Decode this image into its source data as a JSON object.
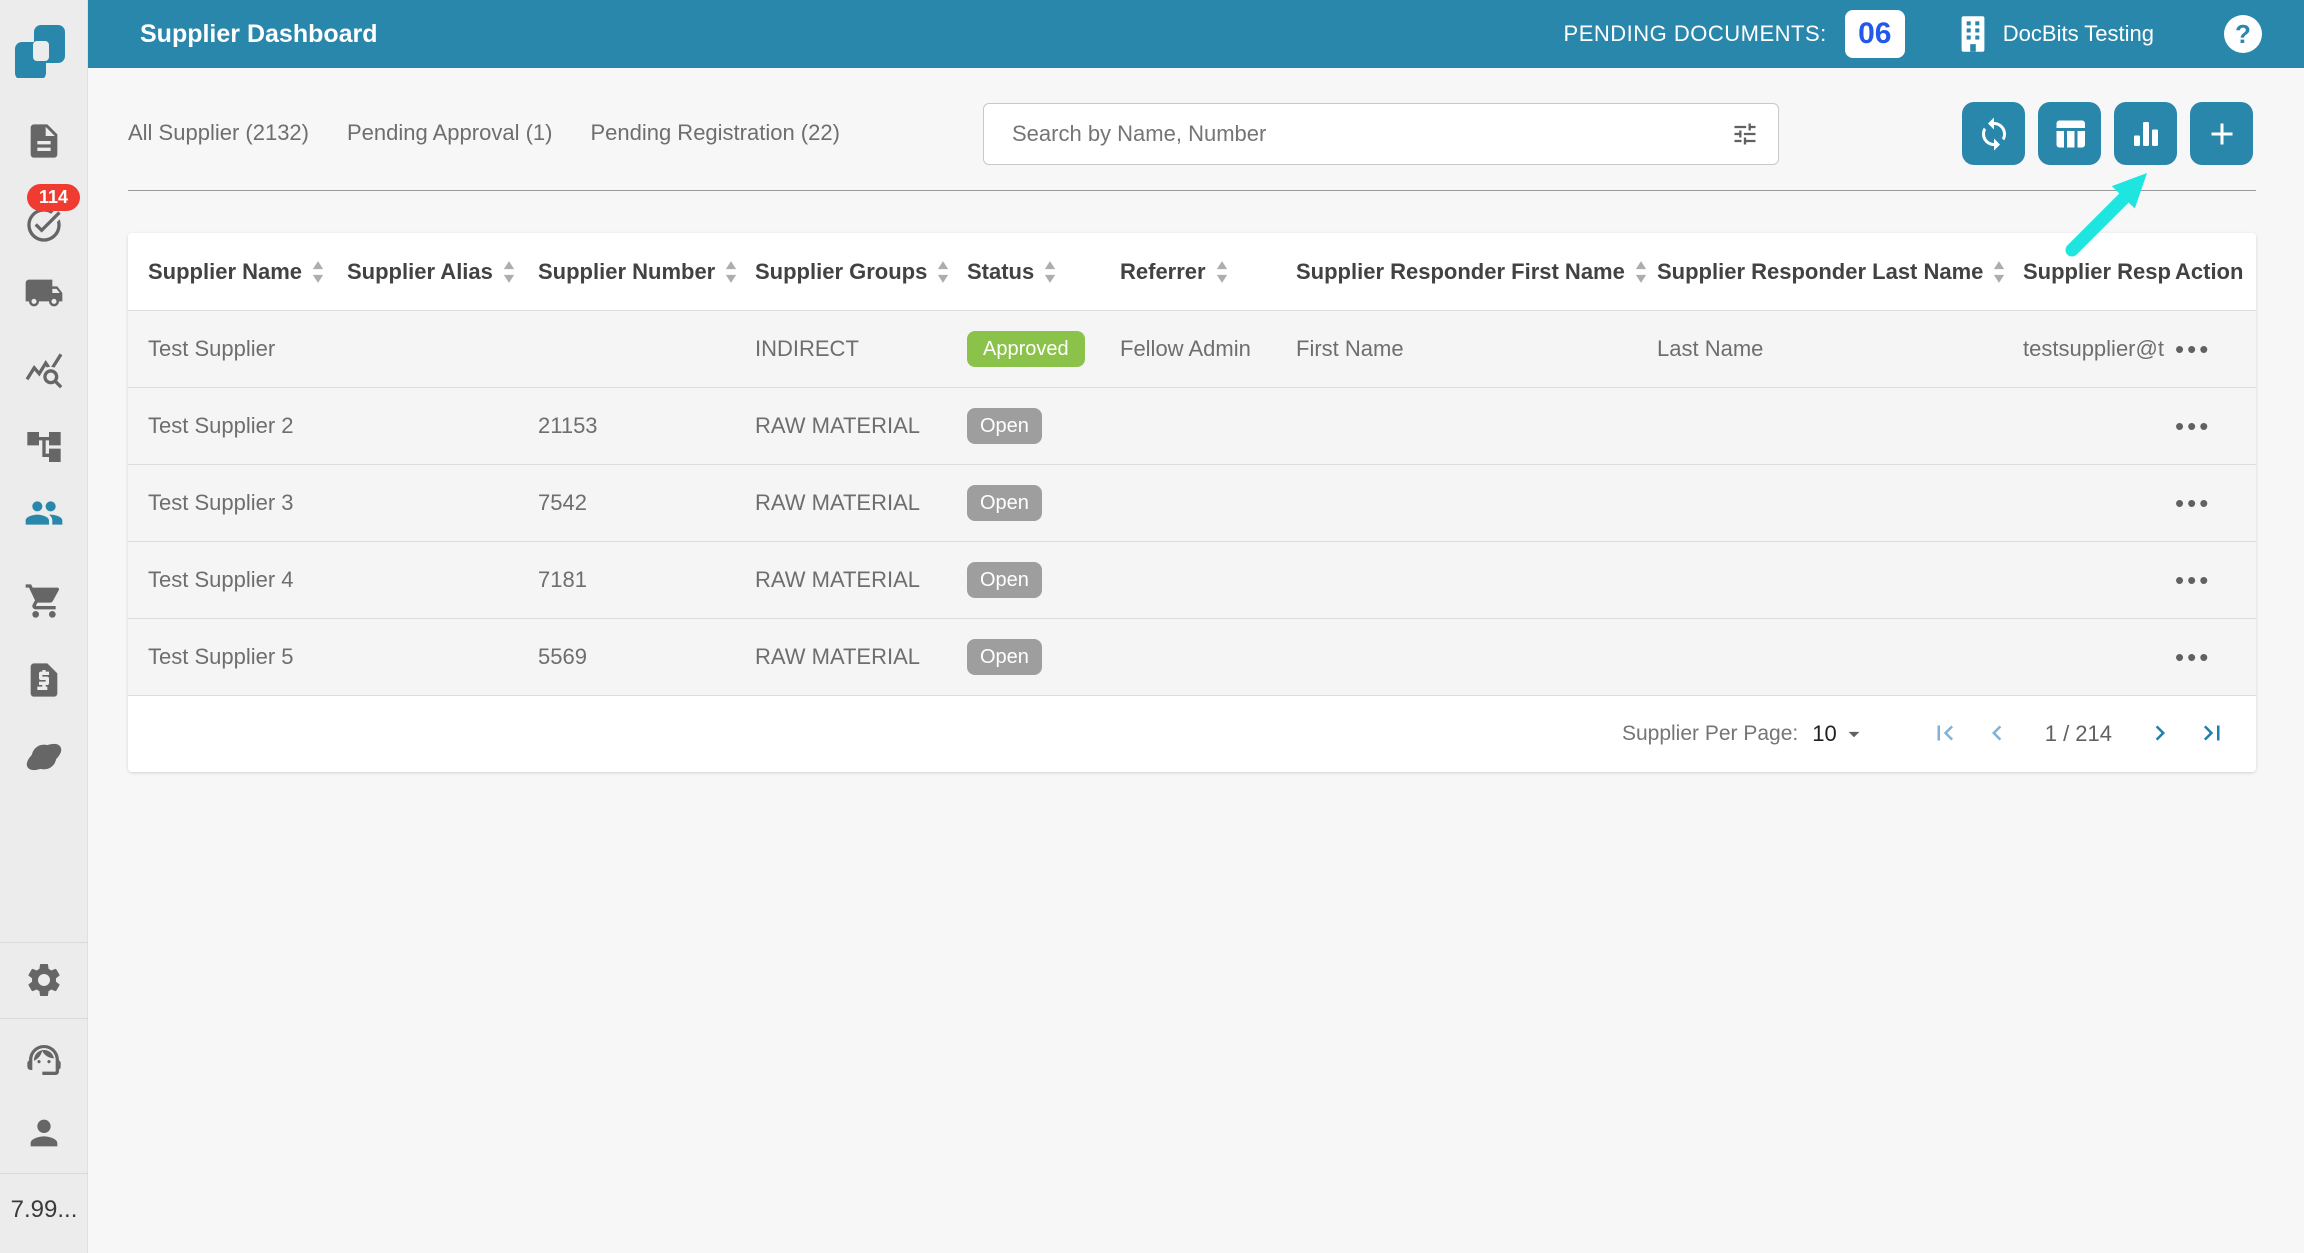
{
  "header": {
    "title": "Supplier Dashboard",
    "pending_documents_label": "PENDING DOCUMENTS:",
    "pending_documents_count": "06",
    "company_name": "DocBits Testing",
    "help_glyph": "?"
  },
  "sidebar": {
    "notification_count": "114",
    "version": "7.99...",
    "items": [
      {
        "icon": "document-icon"
      },
      {
        "icon": "check-circle-icon",
        "badge": "114"
      },
      {
        "icon": "truck-icon"
      },
      {
        "icon": "chart-search-icon"
      },
      {
        "icon": "flow-tree-icon"
      },
      {
        "icon": "people-icon",
        "active": true
      },
      {
        "icon": "cart-icon"
      },
      {
        "icon": "invoice-icon"
      },
      {
        "icon": "orbit-icon"
      },
      {
        "icon": "gear-icon"
      },
      {
        "icon": "headset-icon"
      },
      {
        "icon": "person-icon"
      }
    ]
  },
  "tabs": [
    {
      "label": "All Supplier (2132)"
    },
    {
      "label": "Pending Approval (1)"
    },
    {
      "label": "Pending Registration (22)"
    }
  ],
  "search": {
    "placeholder": "Search by Name, Number"
  },
  "toolbar": {
    "buttons": [
      "refresh-icon",
      "table-columns-icon",
      "bar-chart-icon",
      "plus-icon"
    ]
  },
  "table": {
    "action_menu_glyph": "•••",
    "columns": [
      {
        "key": "name",
        "label": "Supplier Name",
        "sortable": true
      },
      {
        "key": "alias",
        "label": "Supplier Alias",
        "sortable": true
      },
      {
        "key": "number",
        "label": "Supplier Number",
        "sortable": true
      },
      {
        "key": "groups",
        "label": "Supplier Groups",
        "sortable": true
      },
      {
        "key": "status",
        "label": "Status",
        "sortable": true
      },
      {
        "key": "referrer",
        "label": "Referrer",
        "sortable": true
      },
      {
        "key": "responder_first_name",
        "label": "Supplier Responder First Name",
        "sortable": true
      },
      {
        "key": "responder_last_name",
        "label": "Supplier Responder Last Name",
        "sortable": true
      },
      {
        "key": "responder_email",
        "label": "Supplier Resp",
        "sortable": false
      },
      {
        "key": "action",
        "label": "Action",
        "sortable": false
      }
    ],
    "rows": [
      {
        "name": "Test Supplier",
        "alias": "",
        "number": "",
        "groups": "INDIRECT",
        "status": "Approved",
        "status_variant": "approved",
        "referrer": "Fellow Admin",
        "responder_first_name": "First Name",
        "responder_last_name": "Last Name",
        "responder_email": "testsupplier@t"
      },
      {
        "name": "Test Supplier 2",
        "alias": "",
        "number": "21153",
        "groups": "RAW MATERIAL",
        "status": "Open",
        "status_variant": "open",
        "referrer": "",
        "responder_first_name": "",
        "responder_last_name": "",
        "responder_email": ""
      },
      {
        "name": "Test Supplier 3",
        "alias": "",
        "number": "7542",
        "groups": "RAW MATERIAL",
        "status": "Open",
        "status_variant": "open",
        "referrer": "",
        "responder_first_name": "",
        "responder_last_name": "",
        "responder_email": ""
      },
      {
        "name": "Test Supplier 4",
        "alias": "",
        "number": "7181",
        "groups": "RAW MATERIAL",
        "status": "Open",
        "status_variant": "open",
        "referrer": "",
        "responder_first_name": "",
        "responder_last_name": "",
        "responder_email": ""
      },
      {
        "name": "Test Supplier 5",
        "alias": "",
        "number": "5569",
        "groups": "RAW MATERIAL",
        "status": "Open",
        "status_variant": "open",
        "referrer": "",
        "responder_first_name": "",
        "responder_last_name": "",
        "responder_email": ""
      }
    ]
  },
  "pagination": {
    "per_page_label": "Supplier Per Page:",
    "per_page_value": "10",
    "page_indicator": "1 / 214"
  },
  "annotation": {
    "type": "arrow",
    "color": "#1FE5E1",
    "points_to": "bar-chart-button"
  },
  "colors": {
    "accent_teal": "#2A87AC",
    "approved_green": "#8BC34A",
    "open_gray": "#9E9E9E",
    "notification_red": "#EF3B30",
    "count_badge_blue": "#2358EA",
    "arrow_cyan": "#1FE5E1",
    "sidebar_bg": "#ECECEC",
    "page_bg": "#F7F7F7",
    "row_bg": "#F5F5F5"
  }
}
